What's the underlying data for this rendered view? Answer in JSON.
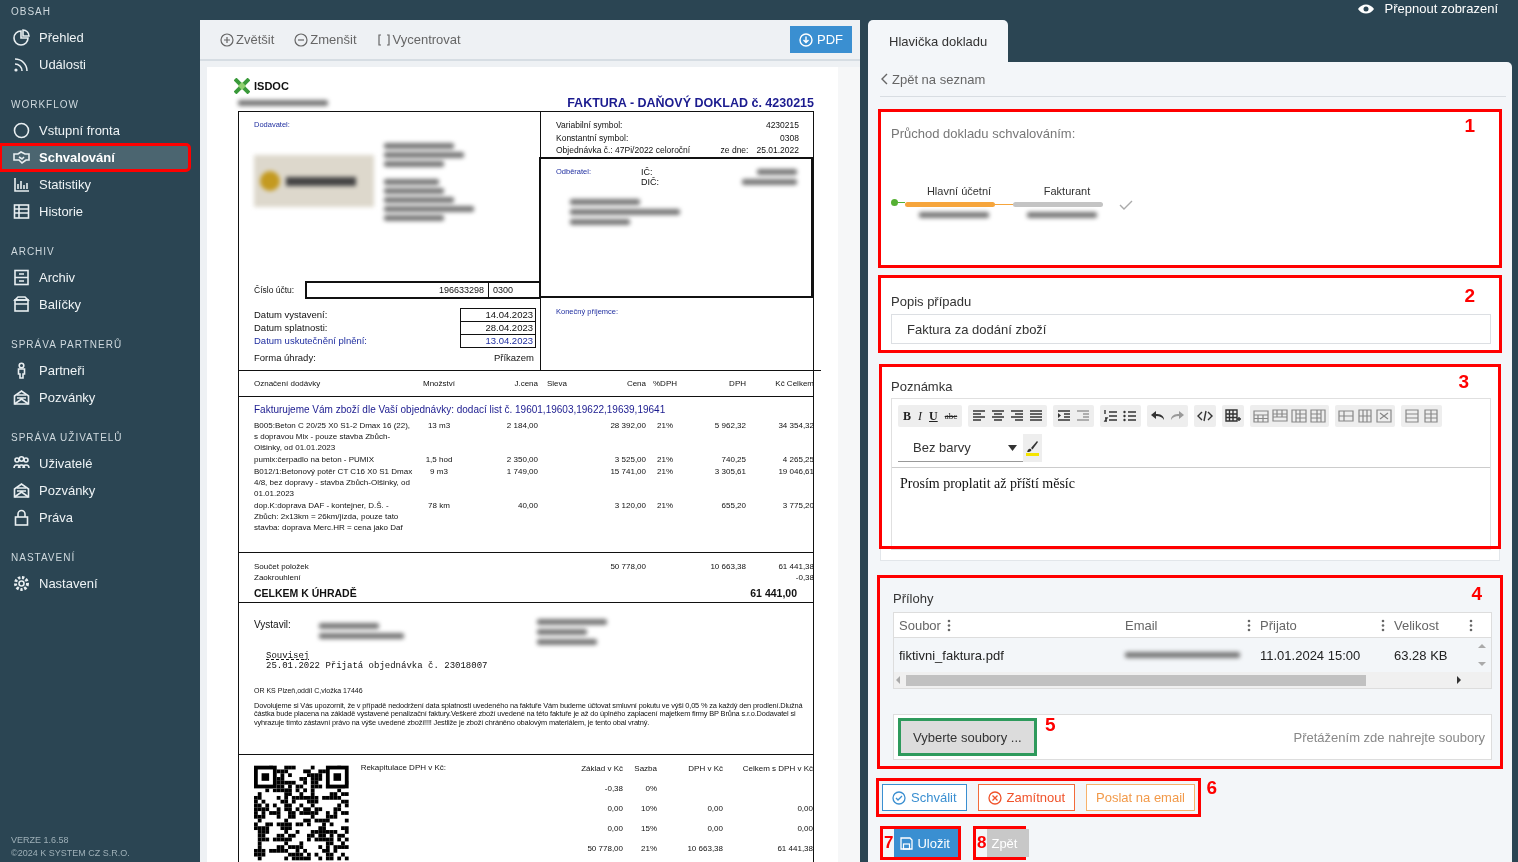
{
  "sidebar": {
    "sections": [
      {
        "heading": "OBSAH",
        "items": [
          {
            "label": "Přehled",
            "selected": false,
            "outlined": false
          },
          {
            "label": "Události",
            "selected": false,
            "outlined": false
          }
        ]
      },
      {
        "heading": "WORKFLOW",
        "items": [
          {
            "label": "Vstupní fronta",
            "selected": false,
            "outlined": false
          },
          {
            "label": "Schvalování",
            "selected": true,
            "outlined": true
          },
          {
            "label": "Statistiky",
            "selected": false,
            "outlined": false
          },
          {
            "label": "Historie",
            "selected": false,
            "outlined": false
          }
        ]
      },
      {
        "heading": "ARCHIV",
        "items": [
          {
            "label": "Archiv",
            "selected": false,
            "outlined": false
          },
          {
            "label": "Balíčky",
            "selected": false,
            "outlined": false
          }
        ]
      },
      {
        "heading": "SPRÁVA PARTNERŮ",
        "items": [
          {
            "label": "Partneři",
            "selected": false,
            "outlined": false
          },
          {
            "label": "Pozvánky",
            "selected": false,
            "outlined": false
          }
        ]
      },
      {
        "heading": "SPRÁVA UŽIVATELŮ",
        "items": [
          {
            "label": "Uživatelé",
            "selected": false,
            "outlined": false
          },
          {
            "label": "Pozvánky",
            "selected": false,
            "outlined": false
          },
          {
            "label": "Práva",
            "selected": false,
            "outlined": false
          }
        ]
      },
      {
        "heading": "NASTAVENÍ",
        "items": [
          {
            "label": "Nastavení",
            "selected": false,
            "outlined": false
          }
        ]
      }
    ],
    "version": "VERZE 1.6.58",
    "copyright": "©2024 K SYSTEM CZ S.R.O."
  },
  "viewer": {
    "toolbar": [
      {
        "label": "Zvětšit",
        "kind": "zoom_in"
      },
      {
        "label": "Zmenšit",
        "kind": "zoom_out"
      },
      {
        "label": "Vycentrovat",
        "kind": "center"
      }
    ],
    "pdf_button": "PDF",
    "document": {
      "logo_text": "ISDOC",
      "title": "FAKTURA - DAŇOVÝ DOKLAD č. 4230215",
      "supplier_label": "Dodavatel:",
      "symbols": [
        {
          "label": "Variabilní symbol:",
          "value": "4230215"
        },
        {
          "label": "Konstantní symbol:",
          "value": "0308"
        }
      ],
      "order": {
        "label": "Objednávka č.: 47Pi/2022 celoroční",
        "date_label": "ze dne:",
        "date": "25.01.2022"
      },
      "customer_label": "Odběratel:",
      "ic_label": "IČ:",
      "dic_label": "DIČ:",
      "account_label": "Číslo účtu:",
      "account_number": "196633298",
      "bank_code": "0300",
      "dates": [
        {
          "label": "Datum vystavení:",
          "value": "14.04.2023",
          "emphasis": false
        },
        {
          "label": "Datum splatnosti:",
          "value": "28.04.2023",
          "emphasis": false
        },
        {
          "label": "Datum uskutečnění plnění:",
          "value": "13.04.2023",
          "emphasis": true
        }
      ],
      "payment_label": "Forma úhrady:",
      "payment_value": "Příkazem",
      "recipient_label": "Konečný příjemce:",
      "columns": [
        "Označení dodávky",
        "Množství",
        "J.cena",
        "Sleva",
        "Cena",
        "%DPH",
        "DPH",
        "Kč Celkem"
      ],
      "intro": "Fakturujeme Vám zboží dle Vaší objednávky: dodací list č. 19601,19603,19622,19639,19641",
      "items": [
        {
          "description": "B005:Beton C 20/25 X0 S1-2 Dmax 16 (22), s dopravou Mix - pouze stavba Zbůch-Olšinky, od 01.01.2023",
          "quantity": "13 m3",
          "unit_price": "2 184,00",
          "price": "28 392,00",
          "vat_rate": "21%",
          "vat": "5 962,32",
          "total": "34 354,32"
        },
        {
          "description": "pumix:čerpadlo na beton - PUMIX",
          "quantity": "1,5 hod",
          "unit_price": "2 350,00",
          "price": "3 525,00",
          "vat_rate": "21%",
          "vat": "740,25",
          "total": "4 265,25"
        },
        {
          "description": "B012/1:Betonový potěr CT C16 X0 S1 Dmax 4/8, bez dopravy - stavba Zbůch-Olšinky, od 01.01.2023",
          "quantity": "9 m3",
          "unit_price": "1 749,00",
          "price": "15 741,00",
          "vat_rate": "21%",
          "vat": "3 305,61",
          "total": "19 046,61"
        },
        {
          "description": "dop.K:doprava DAF - kontejner, D.Š. - Zbůch: 2x13km = 26km/jízda, pouze tato stavba: doprava Merc.HR = cena  jako Daf",
          "quantity": "78 km",
          "unit_price": "40,00",
          "price": "3 120,00",
          "vat_rate": "21%",
          "vat": "655,20",
          "total": "3 775,20"
        }
      ],
      "sum": {
        "label": "Součet položek",
        "price": "50 778,00",
        "vat": "10 663,38",
        "total": "61 441,38"
      },
      "rounding": {
        "label": "Zaokrouhlení",
        "total": "-0,38"
      },
      "grand_total": {
        "label": "CELKEM K ÚHRADĚ",
        "value": "61 441,00"
      },
      "issued_by_label": "Vystavil:",
      "related_heading": "Souvisej",
      "related_line": "25.01.2022 Přijatá objednávka č. 23018007",
      "registry": "OR KS Plzeň,oddíl C,vložka 17446",
      "notice": "Dovolujeme si Vás upozornit, že v případě nedodržení data splatnosti uvedeného na faktuře Vám budeme účtovat smluvní pokutu ve výši 0,05 % za každý den prodlení.Dlužná částka bude placena na základě vystavené penalizační faktury.Veškeré zboží uvedené na této faktuře je až do úplného zaplacení majetkem firmy BP Brůna s.r.o.Dodavatel si vyhrazuje tímto zástavní právo na výše uvedené zboží!!!! Jestliže je zboží chráněno obalovým materiálem, je tento obal vratný.",
      "vat_summary": {
        "label": "Rekapitulace DPH v Kč:",
        "columns": [
          "Základ v Kč",
          "Sazba",
          "DPH v Kč",
          "Celkem s DPH v Kč"
        ],
        "rows": [
          {
            "base": "-0,38",
            "rate": "0%"
          },
          {
            "base": "0,00",
            "rate": "10%",
            "vat": "0,00",
            "total": "0,00"
          },
          {
            "base": "0,00",
            "rate": "15%",
            "vat": "0,00",
            "total": "0,00"
          },
          {
            "base": "50 778,00",
            "rate": "21%",
            "vat": "10 663,38",
            "total": "61 441,38"
          }
        ]
      }
    }
  },
  "detail": {
    "switch_view": "Přepnout zobrazení",
    "tabs": [
      {
        "label": "Hlavička dokladu",
        "selected": true
      }
    ],
    "back_link": "Zpět na seznam",
    "approval": {
      "title": "Průchod dokladu schvalováním:",
      "steps": [
        {
          "role": "Hlavní účetní",
          "current": true
        },
        {
          "role": "Fakturant",
          "current": false
        }
      ],
      "callout": {
        "number": "1",
        "color": "#ff0000"
      }
    },
    "description": {
      "label": "Popis případu",
      "value": "Faktura za dodání zboží",
      "callout": {
        "number": "2",
        "color": "#ff0000"
      }
    },
    "note": {
      "label": "Poznámka",
      "format_buttons": [
        "B",
        "I",
        "U",
        "abc"
      ],
      "color_select": "Bez barvy",
      "text": "Prosím proplatit až příští měsíc",
      "callout": {
        "number": "3",
        "color": "#ff0000"
      }
    },
    "attachments": {
      "title": "Přílohy",
      "columns": [
        "Soubor",
        "Email",
        "Přijato",
        "Velikost"
      ],
      "rows": [
        {
          "file": "fiktivni_faktura.pdf",
          "received": "11.01.2024 15:00",
          "size": "63.28 KB"
        }
      ],
      "choose_button": "Vyberte soubory ...",
      "drop_hint": "Přetážením zde nahrejte soubory",
      "callout": {
        "number": "4",
        "color": "#ff0000"
      },
      "button_callout": {
        "number": "5",
        "color": "#2e9a5c"
      }
    },
    "actions": [
      {
        "label": "Schválit",
        "kind": "approve"
      },
      {
        "label": "Zamítnout",
        "kind": "reject"
      },
      {
        "label": "Poslat na email",
        "kind": "email"
      }
    ],
    "actions_callout": {
      "number": "6",
      "color": "#ff0000"
    },
    "footer_buttons": [
      {
        "label": "Uložit",
        "kind": "save",
        "callout": {
          "number": "7",
          "color": "#ff0000"
        }
      },
      {
        "label": "Zpět",
        "kind": "back",
        "callout": {
          "number": "8",
          "color": "#ff0000"
        }
      }
    ]
  }
}
